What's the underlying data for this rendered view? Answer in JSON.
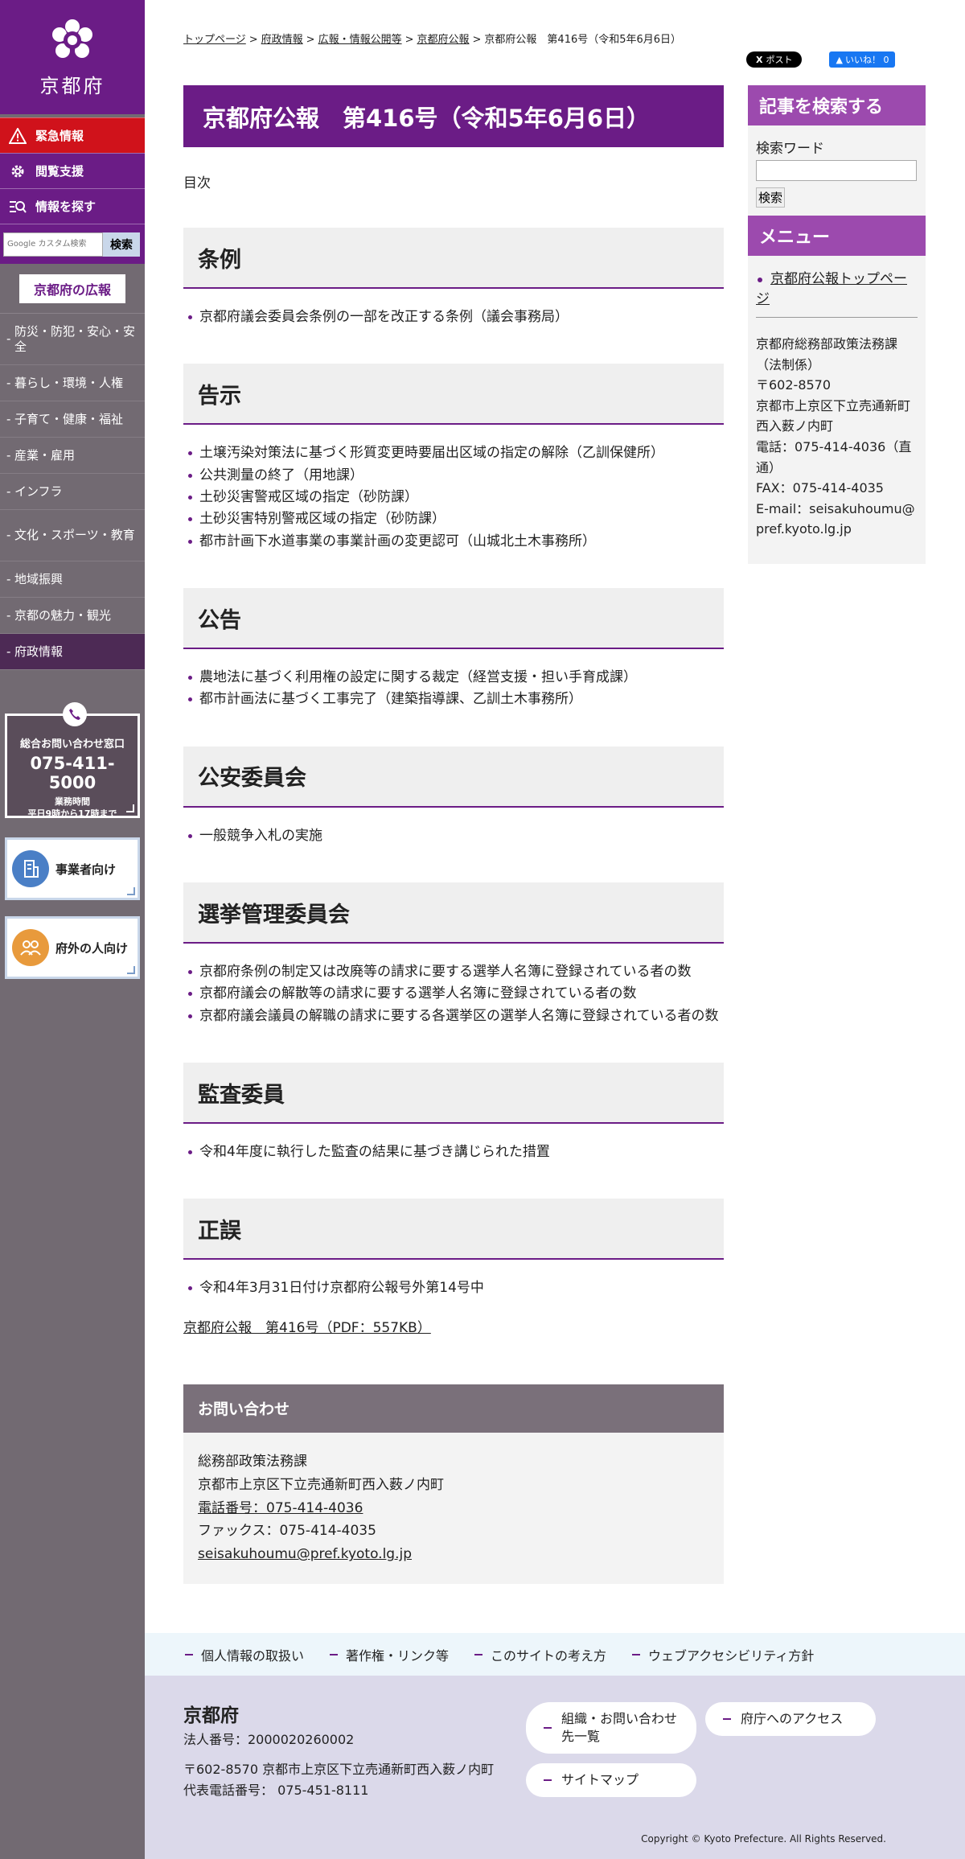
{
  "sidebar": {
    "logo_text": "京都府",
    "utility": [
      {
        "label": "緊急情報",
        "icon": "warning-icon"
      },
      {
        "label": "閲覧支援",
        "icon": "gear-icon"
      },
      {
        "label": "情報を探す",
        "icon": "search-list-icon"
      }
    ],
    "search": {
      "placeholder": "Google カスタム検索",
      "button": "検索"
    },
    "pr_label": "京都府の広報",
    "categories": [
      "防災・防犯・安心・安全",
      "暮らし・環境・人権",
      "子育て・健康・福祉",
      "産業・雇用",
      "インフラ",
      "文化・スポーツ・教育",
      "地域振興",
      "京都の魅力・観光",
      "府政情報"
    ],
    "contact": {
      "label": "総合お問い合わせ窓口",
      "number": "075-411-5000",
      "hours_title": "業務時間",
      "hours": "平日9時から17時まで"
    },
    "audience": [
      {
        "label": "事業者向け",
        "icon": "building-icon",
        "color": "#4a7fc6"
      },
      {
        "label": "府外の人向け",
        "icon": "people-icon",
        "color": "#e89a3c"
      }
    ]
  },
  "breadcrumb": {
    "items": [
      "トップページ",
      "府政情報",
      "広報・情報公開等",
      "京都府公報"
    ],
    "sep": ">",
    "current": "京都府公報　第416号（令和5年6月6日）"
  },
  "social": {
    "x_label": "ポスト",
    "fb_label": "いいね！ 0"
  },
  "main": {
    "title": "京都府公報　第416号（令和5年6月6日）",
    "toc_label": "目次",
    "sections": [
      {
        "heading": "条例",
        "items": [
          "京都府議会委員会条例の一部を改正する条例（議会事務局）"
        ]
      },
      {
        "heading": "告示",
        "items": [
          "土壌汚染対策法に基づく形質変更時要届出区域の指定の解除（乙訓保健所）",
          "公共測量の終了（用地課）",
          "土砂災害警戒区域の指定（砂防課）",
          "土砂災害特別警戒区域の指定（砂防課）",
          "都市計画下水道事業の事業計画の変更認可（山城北土木事務所）"
        ]
      },
      {
        "heading": "公告",
        "items": [
          "農地法に基づく利用権の設定に関する裁定（経営支援・担い手育成課）",
          "都市計画法に基づく工事完了（建築指導課、乙訓土木事務所）"
        ]
      },
      {
        "heading": "公安委員会",
        "items": [
          "一般競争入札の実施"
        ]
      },
      {
        "heading": "選挙管理委員会",
        "items": [
          "京都府条例の制定又は改廃等の請求に要する選挙人名簿に登録されている者の数",
          "京都府議会の解散等の請求に要する選挙人名簿に登録されている者の数",
          "京都府議会議員の解職の請求に要する各選挙区の選挙人名簿に登録されている者の数"
        ]
      },
      {
        "heading": "監査委員",
        "items": [
          "令和4年度に執行した監査の結果に基づき講じられた措置"
        ]
      },
      {
        "heading": "正誤",
        "items": [
          "令和4年3月31日付け京都府公報号外第14号中"
        ]
      }
    ],
    "pdf_link": "京都府公報　第416号（PDF：557KB）",
    "inquiry": {
      "heading": "お問い合わせ",
      "dept": "総務部政策法務課",
      "address": "京都市上京区下立売通新町西入薮ノ内町",
      "phone": "電話番号：075-414-4036",
      "fax": "ファックス：075-414-4035",
      "email": "seisakuhoumu@pref.kyoto.lg.jp"
    }
  },
  "right": {
    "search_heading": "記事を検索する",
    "search_label": "検索ワード",
    "search_button": "検索",
    "menu_heading": "メニュー",
    "menu_link": "京都府公報トップページ",
    "dept_lines": [
      "京都府総務部政策法務課（法制係）",
      "〒602-8570",
      "京都市上京区下立売通新町西入薮ノ内町",
      "電話：075-414-4036（直通）",
      "FAX：075-414-4035",
      "E-mail：seisakuhoumu@pref.kyoto.lg.jp"
    ]
  },
  "footer": {
    "links": [
      "個人情報の取扱い",
      "著作権・リンク等",
      "このサイトの考え方",
      "ウェブアクセシビリティ方針"
    ],
    "org": "京都府",
    "corp_number": "法人番号：2000020260002",
    "address": "〒602-8570 京都市上京区下立売通新町西入薮ノ内町",
    "phone": "代表電話番号： 075-451-8111",
    "buttons": [
      "組織・お問い合わせ先一覧",
      "府庁へのアクセス",
      "サイトマップ"
    ],
    "copyright": "Copyright © Kyoto Prefecture. All Rights Reserved."
  },
  "colors": {
    "brand_purple": "#6b1c86",
    "emergency_red": "#d0121b",
    "sidebar_gray": "#726a72",
    "widget_purple": "#9c4aae"
  }
}
